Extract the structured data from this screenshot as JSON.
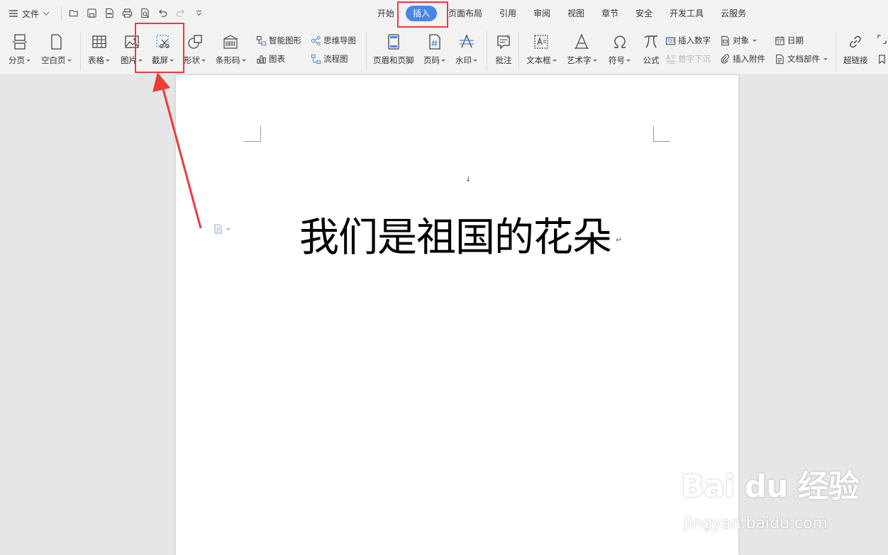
{
  "topbar": {
    "menu_label": "文件",
    "tabs": [
      "开始",
      "插入",
      "页面布局",
      "引用",
      "审阅",
      "视图",
      "章节",
      "安全",
      "开发工具",
      "云服务"
    ],
    "active_tab": "插入"
  },
  "ribbon": {
    "page_break": "分页",
    "blank_page": "空白页",
    "table": "表格",
    "picture": "图片",
    "screenshot": "截屏",
    "shape": "形状",
    "barcode": "条形码",
    "smart_art": "智能图形",
    "chart": "图表",
    "mind_map": "思维导图",
    "flow_chart": "流程图",
    "header_footer": "页眉和页脚",
    "page_number": "页码",
    "watermark": "水印",
    "comment": "批注",
    "text_box": "文本框",
    "word_art": "艺术字",
    "symbol": "符号",
    "formula": "公式",
    "insert_number": "插入数字",
    "drop_cap": "首字下沉",
    "object": "对象",
    "insert_attachment": "插入附件",
    "date": "日期",
    "doc_parts": "文档部件",
    "hyperlink": "超链接"
  },
  "document": {
    "text": "我们是祖国的花朵",
    "paragraph_mark": "↵",
    "top_mark": "↓"
  },
  "watermark": {
    "logo": "Bai du 经验",
    "url": "jingyan.baidu.com"
  },
  "colors": {
    "accent": "#4a86e8",
    "annotation_red": "#f03a3a"
  }
}
